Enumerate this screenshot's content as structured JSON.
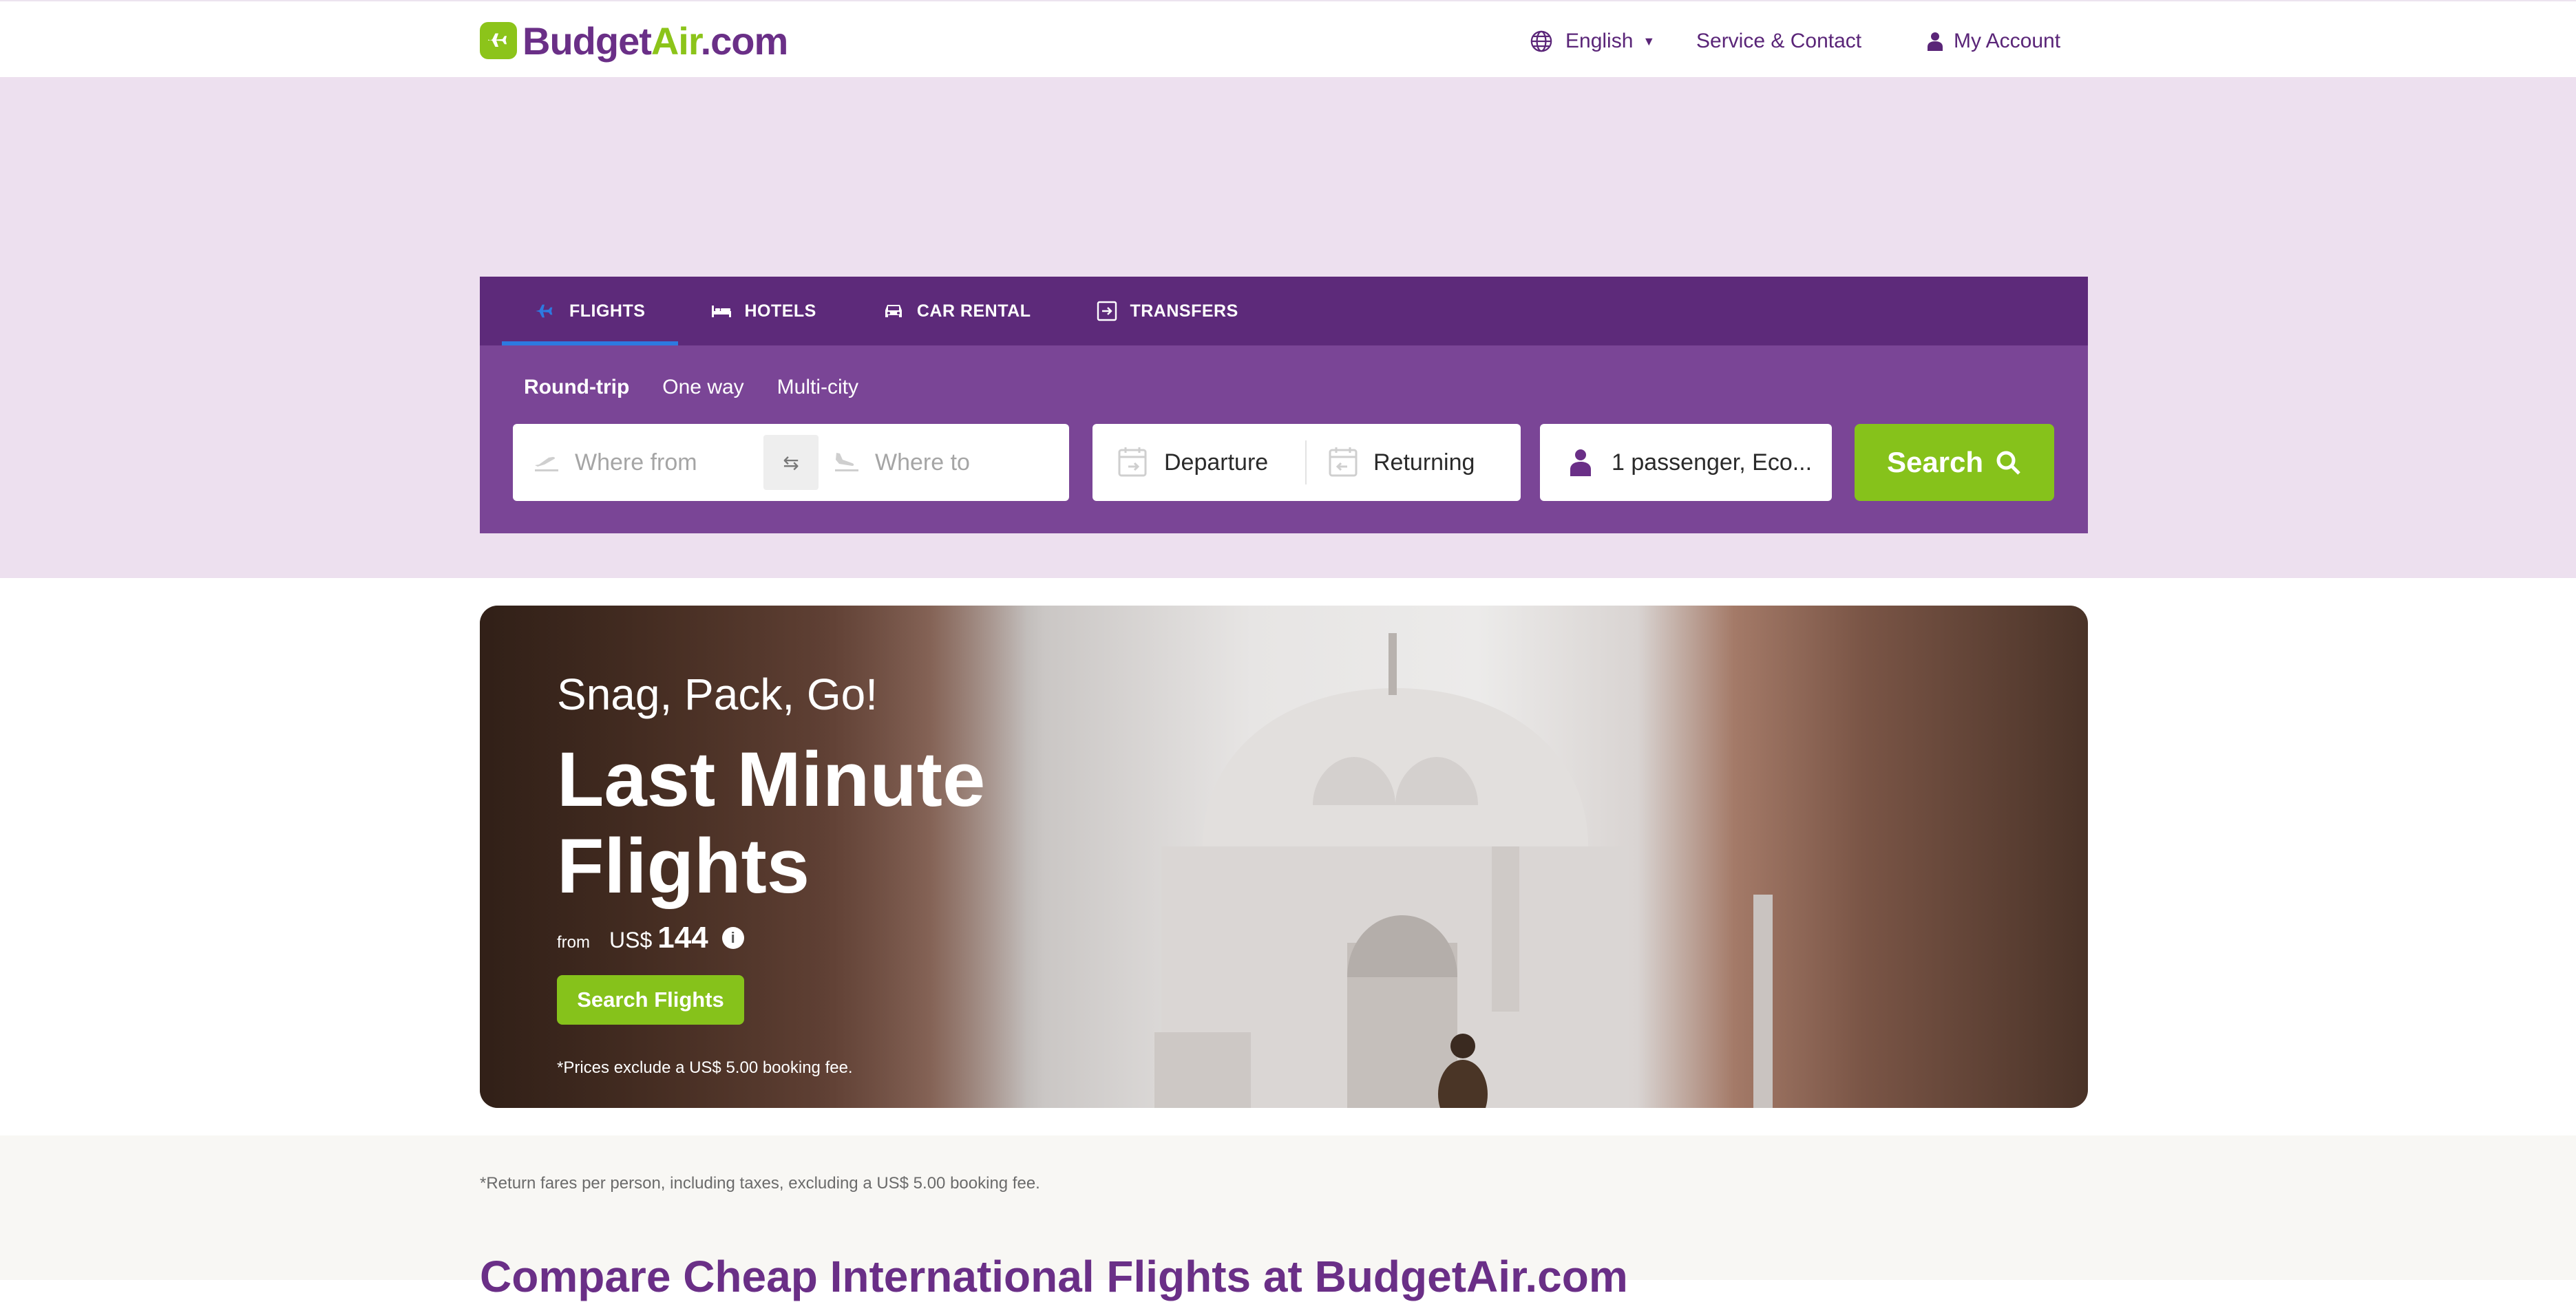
{
  "header": {
    "logo": {
      "budget": "Budget",
      "air": "Air",
      "com": ".com"
    },
    "language": "English",
    "service": "Service & Contact",
    "account": "My Account"
  },
  "search_widget": {
    "tabs": [
      {
        "label": "FLIGHTS",
        "icon": "plane-icon",
        "active": true
      },
      {
        "label": "HOTELS",
        "icon": "bed-icon",
        "active": false
      },
      {
        "label": "CAR RENTAL",
        "icon": "car-icon",
        "active": false
      },
      {
        "label": "TRANSFERS",
        "icon": "transfer-icon",
        "active": false
      }
    ],
    "trip_types": [
      "Round-trip",
      "One way",
      "Multi-city"
    ],
    "from_placeholder": "Where from",
    "to_placeholder": "Where to",
    "departure": "Departure",
    "returning": "Returning",
    "passengers": "1 passenger, Eco...",
    "search_label": "Search"
  },
  "hero": {
    "tagline": "Snag, Pack, Go!",
    "title": "Last Minute Flights",
    "price_from": "from",
    "currency": "US$",
    "price": "144",
    "info_icon": "i",
    "button": "Search Flights",
    "fine_print": "*Prices exclude a US$ 5.00 booking fee."
  },
  "lower": {
    "fare_note": "*Return fares per person, including taxes, excluding a US$ 5.00 booking fee.",
    "seo_title": "Compare Cheap International Flights at BudgetAir.com"
  },
  "colors": {
    "brand_purple": "#6a2f87",
    "widget_purple": "#7a4596",
    "tab_purple": "#5d2a7a",
    "lime": "#86c21b",
    "band": "#ede0ef"
  }
}
